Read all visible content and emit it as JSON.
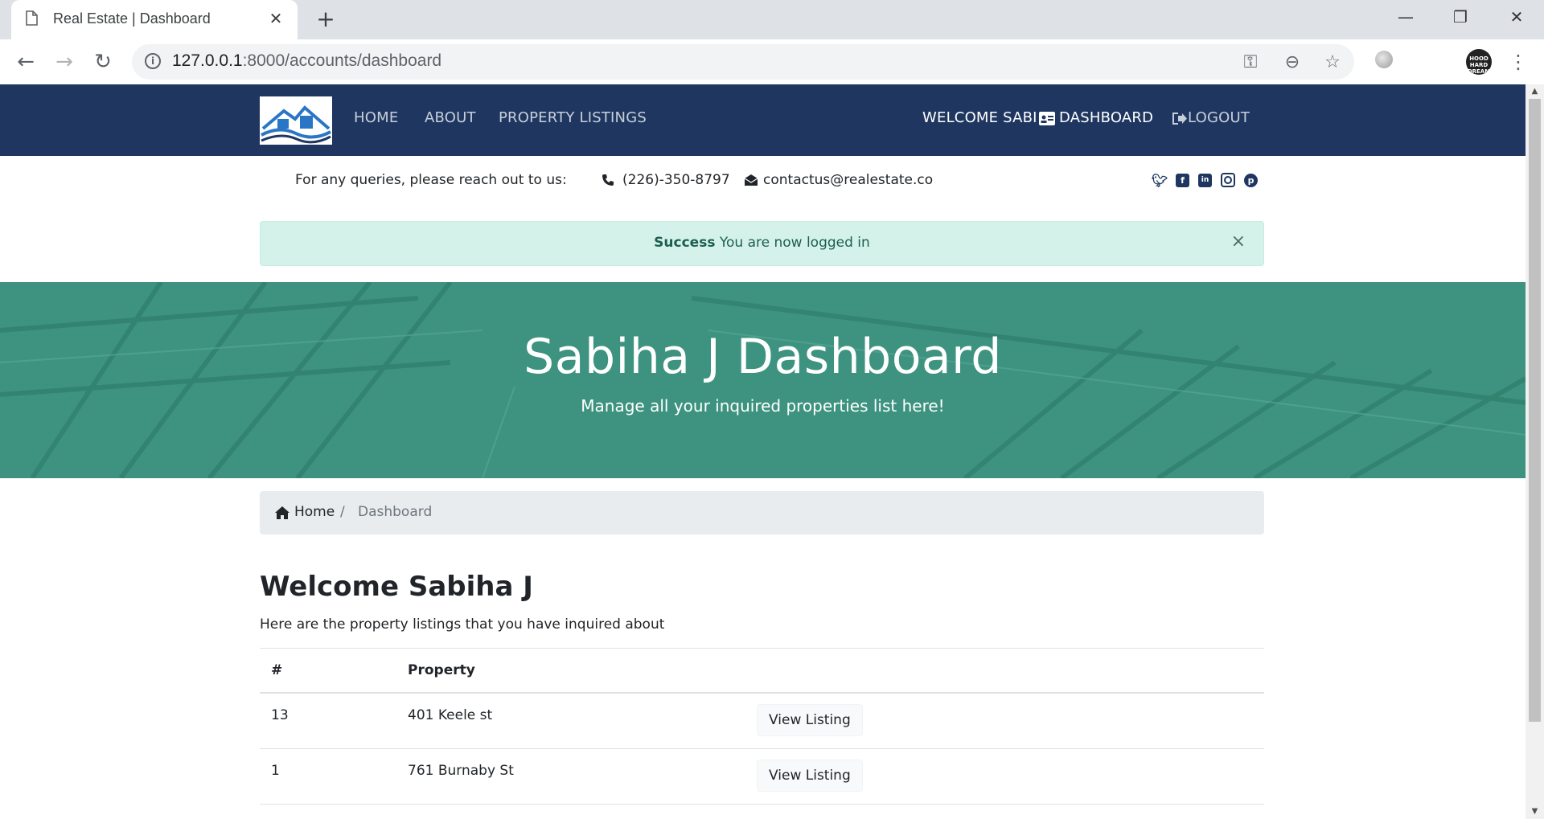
{
  "browser": {
    "tab_title": "Real Estate | Dashboard",
    "url_host": "127.0.0.1",
    "url_rest": ":8000/accounts/dashboard",
    "avatar_text": "HOOD HARD DREAM BIG"
  },
  "nav": {
    "links": [
      "HOME",
      "ABOUT",
      "PROPERTY LISTINGS"
    ],
    "welcome": "WELCOME SABI",
    "dashboard": "DASHBOARD",
    "logout": "LOGOUT"
  },
  "topbar": {
    "queries": "For any queries, please reach out to us:",
    "phone": "(226)-350-8797",
    "email": "contactus@realestate.co",
    "social": [
      "twitter-icon",
      "facebook-icon",
      "linkedin-icon",
      "instagram-icon",
      "pinterest-icon"
    ]
  },
  "alert": {
    "strong": "Success",
    "text": " You are now logged in",
    "close": "×"
  },
  "hero": {
    "title": "Sabiha J Dashboard",
    "subtitle": "Manage all your inquired properties list here!"
  },
  "breadcrumb": {
    "home": "Home",
    "separator": "/",
    "current": "Dashboard"
  },
  "main": {
    "heading": "Welcome Sabiha J",
    "subtext": "Here are the property listings that you have inquired about",
    "table": {
      "headers": [
        "#",
        "Property",
        ""
      ],
      "rows": [
        {
          "id": "13",
          "property": "401 Keele st",
          "action": "View Listing"
        },
        {
          "id": "1",
          "property": "761 Burnaby St",
          "action": "View Listing"
        }
      ]
    }
  },
  "colors": {
    "navbar": "#1f3760",
    "hero": "#3e9380",
    "alert_bg": "#d4f2ea"
  }
}
